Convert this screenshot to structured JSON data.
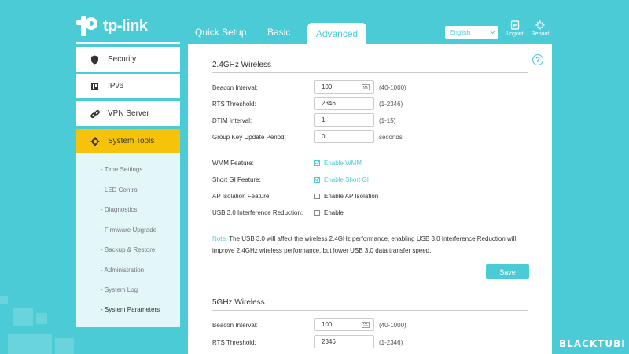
{
  "brand": {
    "logo_text": "tp-link",
    "accent": "#4acbd6",
    "active": "#f7c30a"
  },
  "nav": {
    "tabs": [
      "Quick Setup",
      "Basic",
      "Advanced"
    ],
    "active_tab": "Advanced",
    "language": "English",
    "logout_label": "Logout",
    "reboot_label": "Reboot"
  },
  "sidebar": {
    "items": [
      {
        "label": "Security",
        "icon": "shield-icon"
      },
      {
        "label": "IPv6",
        "icon": "ipv6-icon"
      },
      {
        "label": "VPN Server",
        "icon": "link-icon"
      },
      {
        "label": "System Tools",
        "icon": "gear-icon"
      }
    ],
    "active_item": "System Tools",
    "subitems": [
      "- Time Settings",
      "- LED Control",
      "- Diagnostics",
      "- Firmware Upgrade",
      "- Backup & Restore",
      "- Administration",
      "- System Log",
      "- System Parameters"
    ],
    "active_subitem": "- System Parameters"
  },
  "wireless_24": {
    "title": "2.4GHz Wireless",
    "beacon_label": "Beacon Interval:",
    "beacon_value": "100",
    "beacon_hint": "(40-1000)",
    "rts_label": "RTS Threshold:",
    "rts_value": "2346",
    "rts_hint": "(1-2346)",
    "dtim_label": "DTIM Interval:",
    "dtim_value": "1",
    "dtim_hint": "(1-15)",
    "gk_label": "Group Key Update Period:",
    "gk_value": "0",
    "gk_hint": "seconds",
    "wmm_label": "WMM Feature:",
    "wmm_option": "Enable WMM",
    "sgi_label": "Short GI Feature:",
    "sgi_option": "Enable Short GI",
    "ap_label": "AP Isolation Feature:",
    "ap_option": "Enable AP Isolation",
    "usb_label": "USB 3.0 Interference Reduction:",
    "usb_option": "Enable",
    "note_key": "Note:",
    "note_text": "The USB 3.0 will affect the wireless 2.4GHz performance, enabling USB 3.0 Interference Reduction will improve 2.4GHz wireless performance, but lower USB 3.0 data transfer speed.",
    "save_label": "Save"
  },
  "wireless_5": {
    "title": "5GHz Wireless",
    "beacon_label": "Beacon Interval:",
    "beacon_value": "100",
    "beacon_hint": "(40-1000)",
    "rts_label": "RTS Threshold:",
    "rts_value": "2346",
    "rts_hint": "(1-2346)"
  },
  "help_symbol": "?",
  "watermark": "BLACKTUBI"
}
